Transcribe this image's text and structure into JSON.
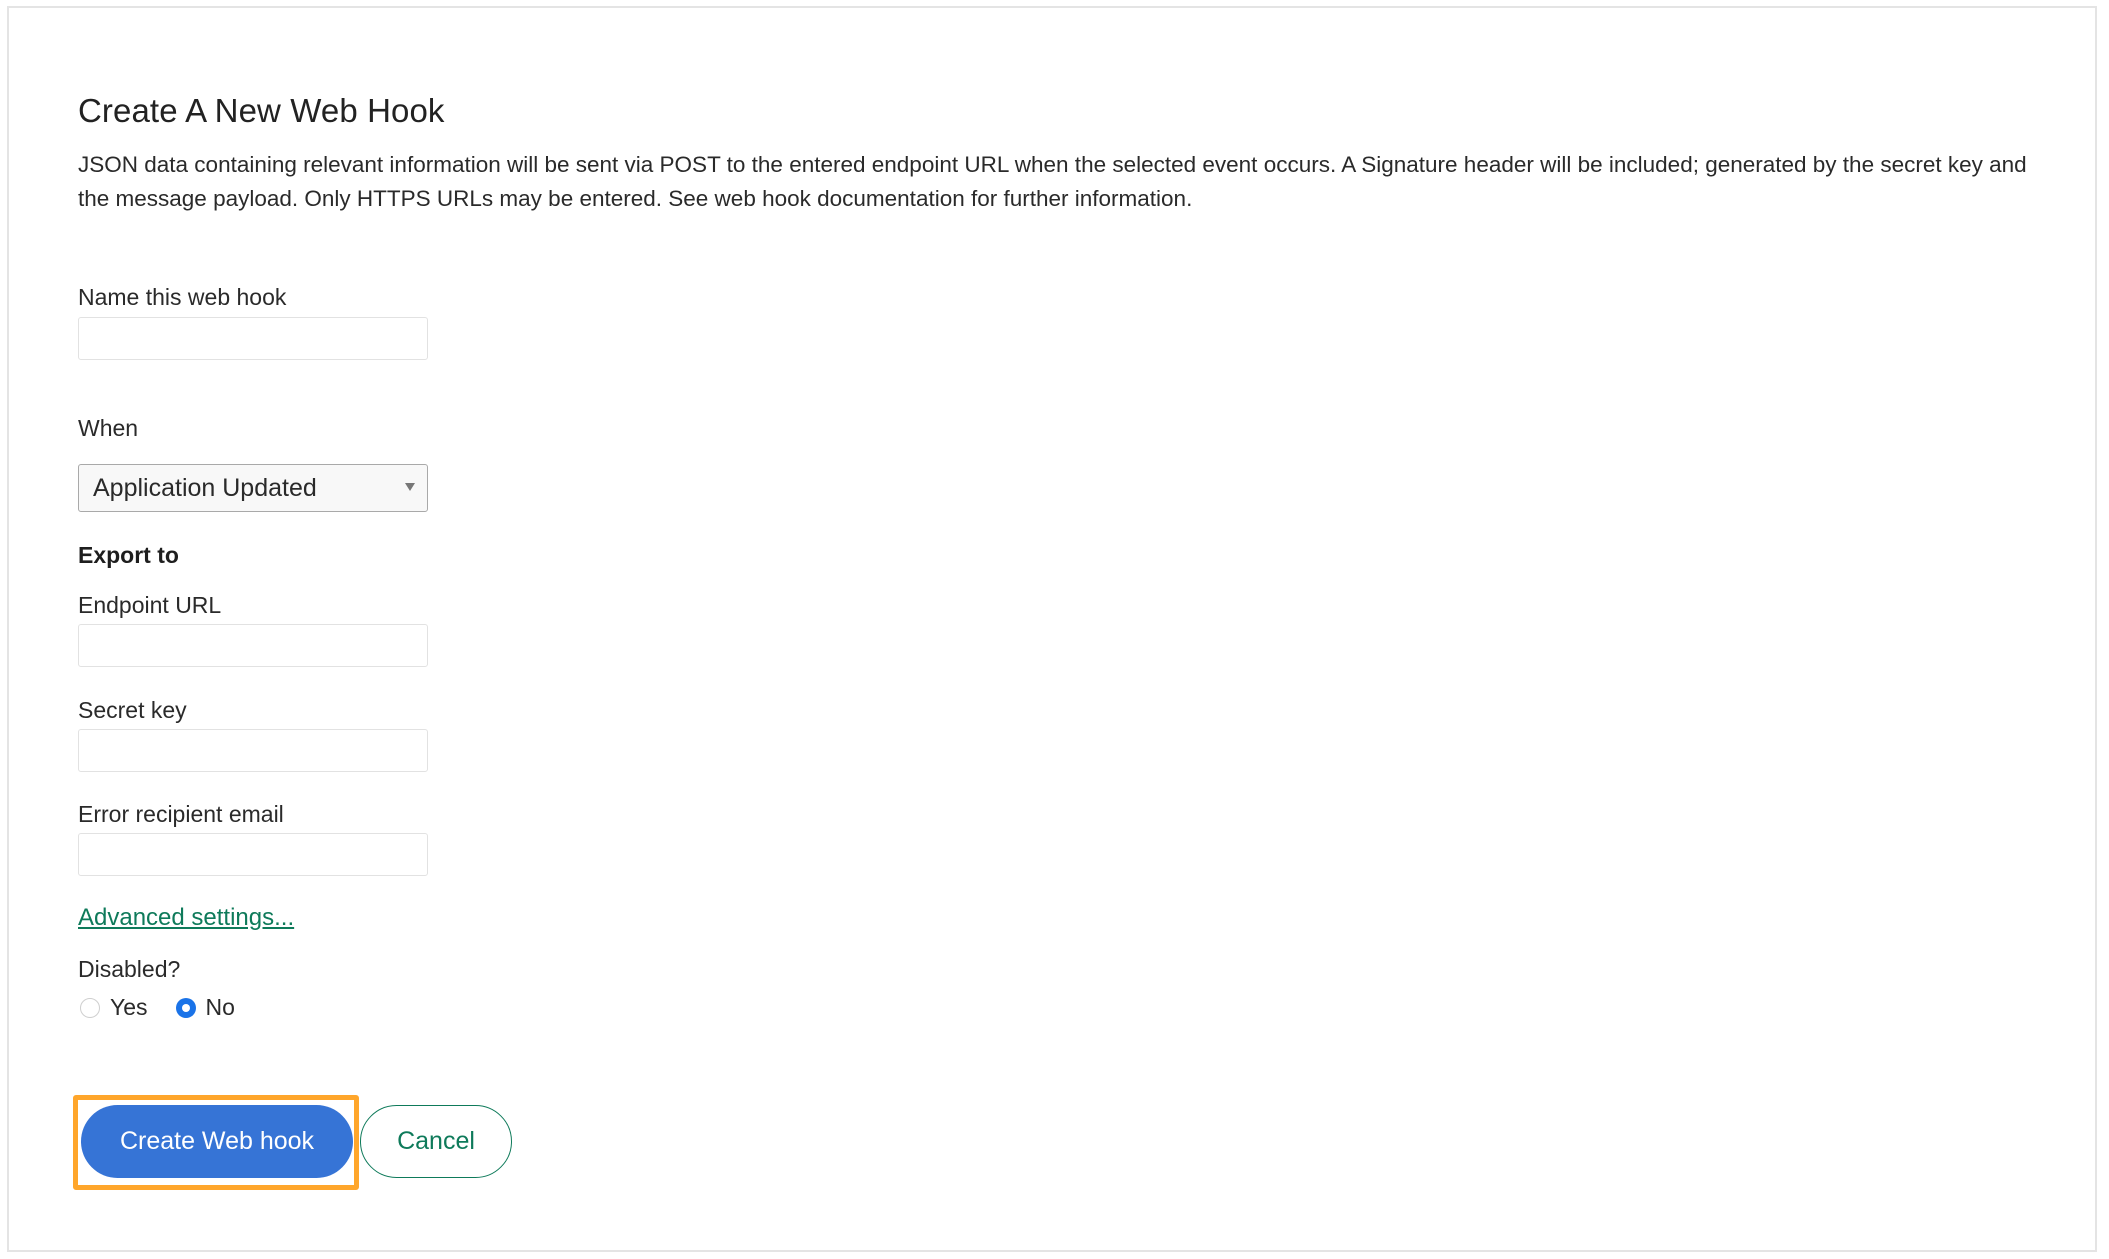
{
  "page": {
    "title": "Create A New Web Hook",
    "description": "JSON data containing relevant information will be sent via POST to the entered endpoint URL when the selected event occurs. A Signature header will be included; generated by the secret key and the message payload. Only HTTPS URLs may be entered. See web hook documentation for further information."
  },
  "form": {
    "name": {
      "label": "Name this web hook",
      "value": "",
      "placeholder": ""
    },
    "when": {
      "label": "When",
      "selected": "Application Updated"
    },
    "export_heading": "Export to",
    "endpoint_url": {
      "label": "Endpoint URL",
      "value": "",
      "placeholder": ""
    },
    "secret_key": {
      "label": "Secret key",
      "value": "",
      "placeholder": ""
    },
    "error_email": {
      "label": "Error recipient email",
      "value": "",
      "placeholder": ""
    },
    "advanced_link": "Advanced settings...",
    "disabled": {
      "label": "Disabled?",
      "options": [
        {
          "label": "Yes",
          "checked": false
        },
        {
          "label": "No",
          "checked": true
        }
      ]
    }
  },
  "actions": {
    "create_label": "Create Web hook",
    "cancel_label": "Cancel"
  },
  "colors": {
    "primary": "#3674d6",
    "link": "#0e7a5a",
    "highlight": "#ffa62b",
    "radio_checked": "#1a73e8"
  }
}
